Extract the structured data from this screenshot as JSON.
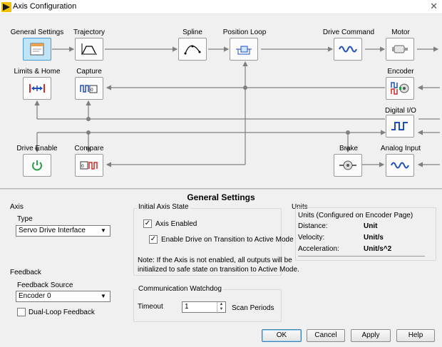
{
  "window": {
    "title": "Axis Configuration"
  },
  "diagram": {
    "blocks": {
      "general_settings": "General Settings",
      "trajectory": "Trajectory",
      "spline": "Spline",
      "position_loop": "Position Loop",
      "drive_command": "Drive Command",
      "motor": "Motor",
      "limits_home": "Limits & Home",
      "capture": "Capture",
      "encoder": "Encoder",
      "digital_io": "Digital I/O",
      "drive_enable": "Drive Enable",
      "compare": "Compare",
      "brake": "Brake",
      "analog_input": "Analog Input"
    },
    "selected_block": "General Settings"
  },
  "panel": {
    "title": "General Settings"
  },
  "axis": {
    "group_label": "Axis",
    "type_label": "Type",
    "type_value": "Servo Drive Interface"
  },
  "feedback": {
    "group_label": "Feedback",
    "source_label": "Feedback Source",
    "source_value": "Encoder 0",
    "dual_loop_label": "Dual-Loop Feedback",
    "dual_loop_checked": false
  },
  "initial_state": {
    "group_label": "Initial Axis State",
    "axis_enabled_label": "Axis Enabled",
    "axis_enabled_checked": true,
    "enable_drive_label": "Enable Drive on Transition to Active Mode",
    "enable_drive_checked": true,
    "note_line1": "Note: If the Axis is not enabled, all outputs will be",
    "note_line2": "initialized to safe state on transition to Active Mode."
  },
  "watchdog": {
    "group_label": "Communication Watchdog",
    "timeout_label": "Timeout",
    "timeout_value": "1",
    "timeout_unit": "Scan Periods"
  },
  "units": {
    "group_label": "Units",
    "subtitle": "Units (Configured on Encoder Page)",
    "rows": [
      {
        "label": "Distance:",
        "value": "Unit"
      },
      {
        "label": "Velocity:",
        "value": "Unit/s"
      },
      {
        "label": "Acceleration:",
        "value": "Unit/s^2"
      }
    ]
  },
  "buttons": {
    "ok": "OK",
    "cancel": "Cancel",
    "apply": "Apply",
    "help": "Help"
  },
  "icons": {
    "app": "labview-icon",
    "close": "close-icon",
    "check": "✓",
    "dropdown": "▼"
  },
  "colors": {
    "selected_block_bg": "#bfe3f7",
    "wire": "#7f7f7f",
    "icon_blue": "#1f4fb8",
    "icon_red": "#d42a2a"
  }
}
